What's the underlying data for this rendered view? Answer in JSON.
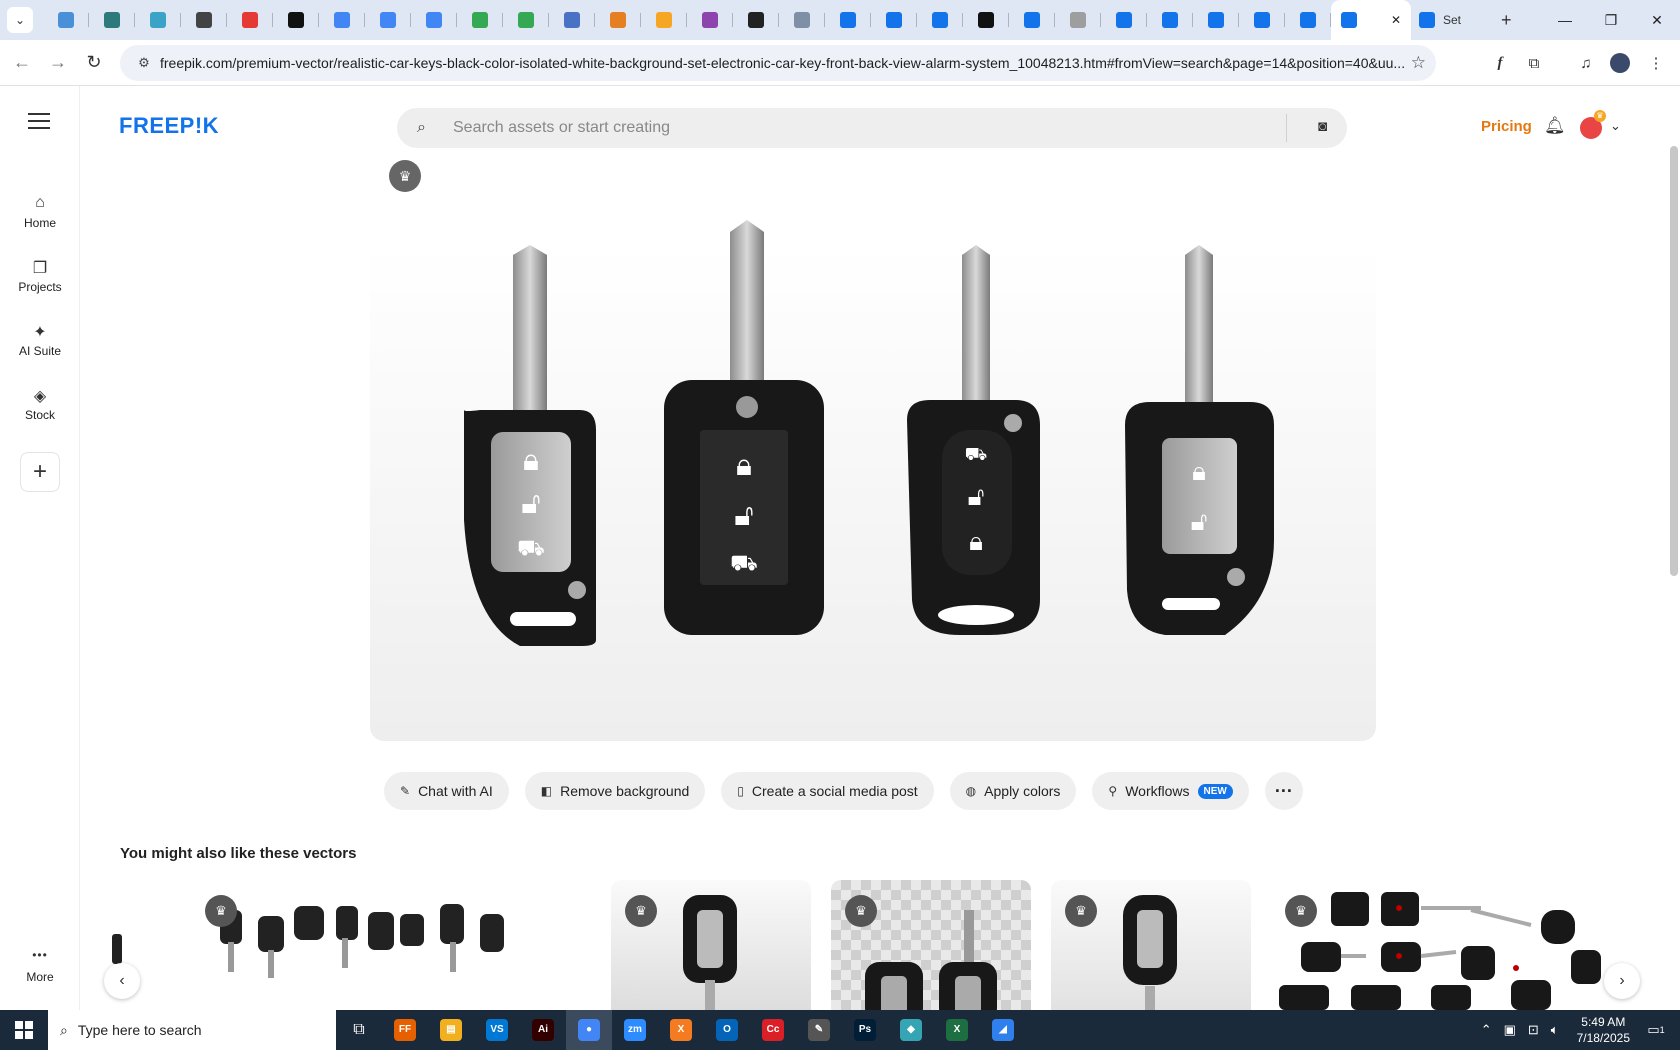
{
  "browser": {
    "tab_menu_icon": "chevron-down",
    "tabs": [
      {
        "color": "#4a90d9"
      },
      {
        "color": "#2c7a7b"
      },
      {
        "color": "#3aa3c6"
      },
      {
        "color": "#444444"
      },
      {
        "color": "#e53935"
      },
      {
        "color": "#111111"
      },
      {
        "color": "#4285f4"
      },
      {
        "color": "#4285f4"
      },
      {
        "color": "#4285f4"
      },
      {
        "color": "#34a853"
      },
      {
        "color": "#34a853"
      },
      {
        "color": "#4a72c4"
      },
      {
        "color": "#e67e22"
      },
      {
        "color": "#f5a623"
      },
      {
        "color": "#8e44ad"
      },
      {
        "color": "#222222"
      },
      {
        "color": "#7f8fa6"
      },
      {
        "color": "#1273eb"
      },
      {
        "color": "#1273eb"
      },
      {
        "color": "#1273eb"
      },
      {
        "color": "#111111"
      },
      {
        "color": "#1273eb"
      },
      {
        "color": "#9e9e9e"
      },
      {
        "color": "#1273eb"
      },
      {
        "color": "#1273eb"
      },
      {
        "color": "#1273eb"
      },
      {
        "color": "#1273eb"
      },
      {
        "color": "#1273eb"
      }
    ],
    "active_tab_close": "✕",
    "last_tab_title": "Set",
    "new_tab": "+",
    "url": "freepik.com/premium-vector/realistic-car-keys-black-color-isolated-white-background-set-electronic-car-key-front-back-view-alarm-system_10048213.htm#fromView=search&page=14&position=40&uu..."
  },
  "nav": {
    "items": [
      {
        "label": "Home",
        "icon": "⌂"
      },
      {
        "label": "Projects",
        "icon": "❐"
      },
      {
        "label": "AI Suite",
        "icon": "✦"
      },
      {
        "label": "Stock",
        "icon": "◈"
      }
    ],
    "add": "+",
    "more_label": "More",
    "more_icon": "•••"
  },
  "header": {
    "logo": "FREEP!K",
    "search_placeholder": "Search assets or start creating",
    "pricing": "Pricing"
  },
  "actions": [
    {
      "label": "Chat with AI",
      "icon": "✎"
    },
    {
      "label": "Remove background",
      "icon": "◧"
    },
    {
      "label": "Create a social media post",
      "icon": "▯"
    },
    {
      "label": "Apply colors",
      "icon": "◍"
    },
    {
      "label": "Workflows",
      "icon": "⚲",
      "badge": "NEW"
    }
  ],
  "related": {
    "title": "You might also like these vectors"
  },
  "taskbar": {
    "search_placeholder": "Type here to search",
    "apps": [
      {
        "label": "FF",
        "color": "#e66000"
      },
      {
        "label": "▤",
        "color": "#f2b01e"
      },
      {
        "label": "VS",
        "color": "#0078d4"
      },
      {
        "label": "Ai",
        "color": "#330000"
      },
      {
        "label": "●",
        "color": "#4285f4"
      },
      {
        "label": "zm",
        "color": "#2d8cff"
      },
      {
        "label": "X",
        "color": "#f47b20"
      },
      {
        "label": "O",
        "color": "#0364b8"
      },
      {
        "label": "Cc",
        "color": "#da1f26"
      },
      {
        "label": "✎",
        "color": "#555555"
      },
      {
        "label": "Ps",
        "color": "#001e36"
      },
      {
        "label": "◆",
        "color": "#36a5b3"
      },
      {
        "label": "X",
        "color": "#1d6f42"
      },
      {
        "label": "◢",
        "color": "#2f80ed"
      }
    ],
    "time": "5:49 AM",
    "date": "7/18/2025",
    "notif_count": "1"
  }
}
